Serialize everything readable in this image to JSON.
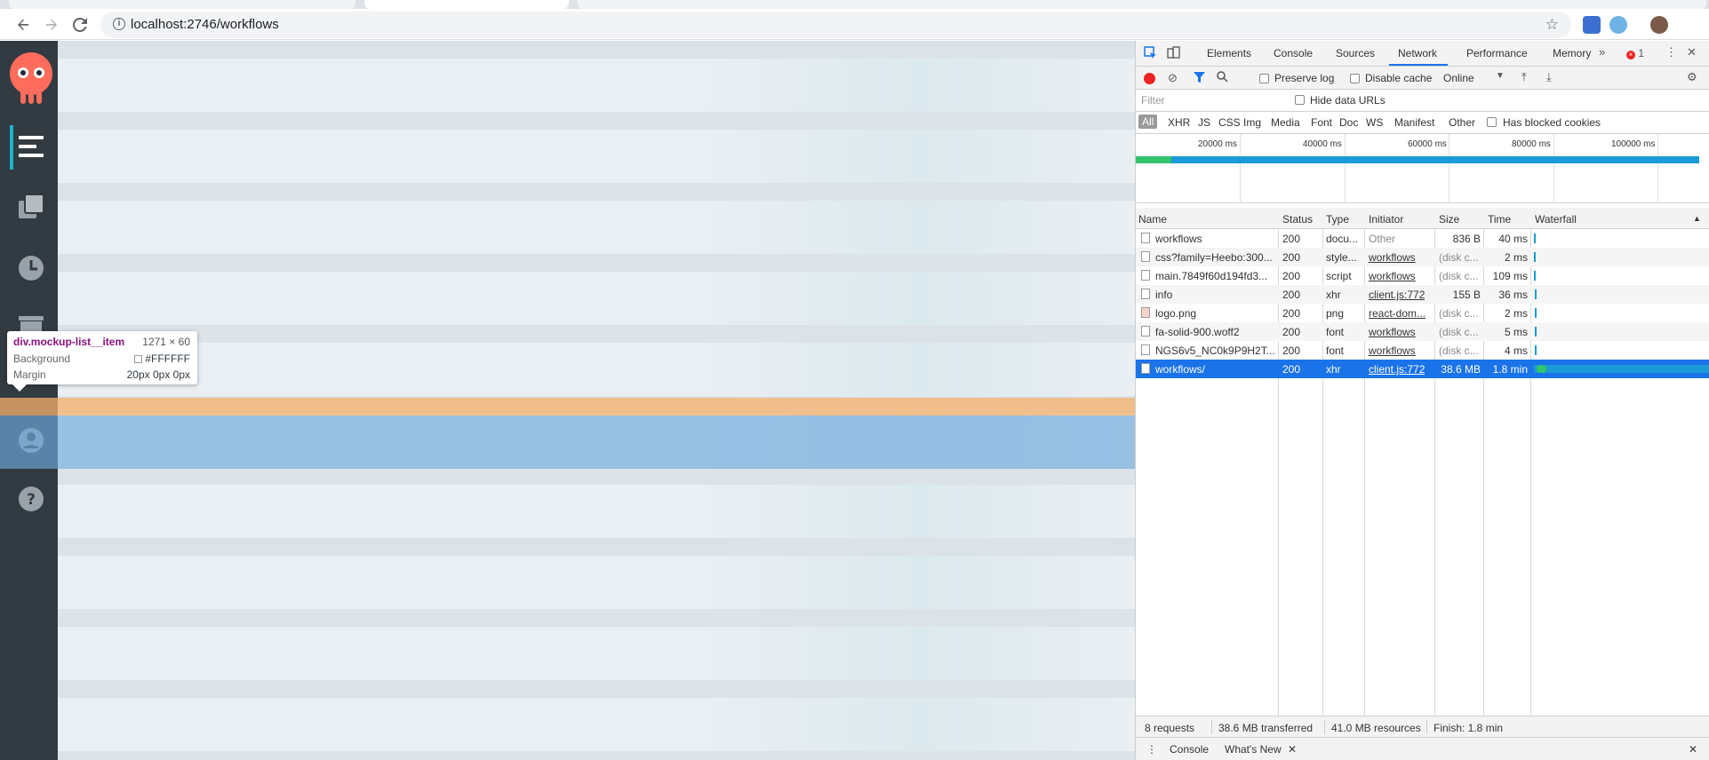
{
  "browser": {
    "url": "localhost:2746/workflows"
  },
  "sidebar": {
    "items": [
      {
        "icon": "workflows-list-icon"
      },
      {
        "icon": "templates-icon"
      },
      {
        "icon": "cron-clock-icon"
      },
      {
        "icon": "archive-icon"
      },
      {
        "icon": "user-icon"
      },
      {
        "icon": "help-icon"
      }
    ]
  },
  "inspect_tooltip": {
    "selector": "div.mockup-list__item",
    "size": "1271 × 60",
    "background_label": "Background",
    "background_value": "#FFFFFF",
    "margin_label": "Margin",
    "margin_value": "20px 0px 0px"
  },
  "devtools": {
    "tabs": [
      "Elements",
      "Console",
      "Sources",
      "Network",
      "Performance",
      "Memory"
    ],
    "active_tab": "Network",
    "error_count": "1",
    "preserve_log": "Preserve log",
    "disable_cache": "Disable cache",
    "throttle": "Online",
    "filter_placeholder": "Filter",
    "hide_data_urls": "Hide data URLs",
    "filter_types": [
      "All",
      "XHR",
      "JS",
      "CSS",
      "Img",
      "Media",
      "Font",
      "Doc",
      "WS",
      "Manifest",
      "Other"
    ],
    "has_blocked_cookies": "Has blocked cookies",
    "overview_ticks": [
      "20000 ms",
      "40000 ms",
      "60000 ms",
      "80000 ms",
      "100000 ms"
    ],
    "columns": [
      "Name",
      "Status",
      "Type",
      "Initiator",
      "Size",
      "Time",
      "Waterfall"
    ],
    "requests": [
      {
        "name": "workflows",
        "status": "200",
        "type": "docu...",
        "initiator": "Other",
        "size": "836 B",
        "time": "40 ms"
      },
      {
        "name": "css?family=Heebo:300...",
        "status": "200",
        "type": "style...",
        "initiator": "workflows",
        "size": "(disk c...",
        "time": "2 ms"
      },
      {
        "name": "main.7849f60d194fd3...",
        "status": "200",
        "type": "script",
        "initiator": "workflows",
        "size": "(disk c...",
        "time": "109 ms"
      },
      {
        "name": "info",
        "status": "200",
        "type": "xhr",
        "initiator": "client.js:772",
        "size": "155 B",
        "time": "36 ms"
      },
      {
        "name": "logo.png",
        "status": "200",
        "type": "png",
        "initiator": "react-dom...",
        "size": "(disk c...",
        "time": "2 ms"
      },
      {
        "name": "fa-solid-900.woff2",
        "status": "200",
        "type": "font",
        "initiator": "workflows",
        "size": "(disk c...",
        "time": "5 ms"
      },
      {
        "name": "NGS6v5_NC0k9P9H2T...",
        "status": "200",
        "type": "font",
        "initiator": "workflows",
        "size": "(disk c...",
        "time": "4 ms"
      },
      {
        "name": "workflows/",
        "status": "200",
        "type": "xhr",
        "initiator": "client.js:772",
        "size": "38.6 MB",
        "time": "1.8 min"
      }
    ],
    "summary": {
      "requests": "8 requests",
      "transferred": "38.6 MB transferred",
      "resources": "41.0 MB resources",
      "finish": "Finish: 1.8 min"
    },
    "drawer_tabs": [
      "Console",
      "What's New"
    ]
  }
}
